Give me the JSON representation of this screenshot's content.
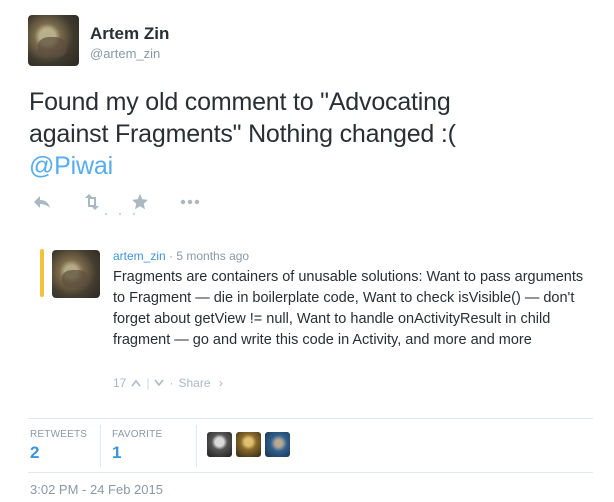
{
  "author": {
    "display_name": "Artem Zin",
    "handle": "@artem_zin"
  },
  "tweet": {
    "text_line1": "Found my old comment to \"Advocating",
    "text_line2": "against Fragments\" Nothing changed :(",
    "mention": "@Piwai"
  },
  "actions": {
    "icons": [
      "reply-icon",
      "retweet-icon",
      "favorite-icon",
      "more-icon"
    ]
  },
  "quoted": {
    "username": "artem_zin",
    "separator": "·",
    "time": "5 months ago",
    "text": "Fragments are containers of unusable solutions: Want to pass arguments to Fragment — die in boilerplate code, Want to check isVisible() — don't forget about getView != null, Want to handle onActivityResult in child fragment — go and write this code in Activity, and more and more",
    "votes": "17",
    "share_label": "Share",
    "accent_color": "#f2c23a"
  },
  "stats": {
    "retweets_label": "RETWEETS",
    "retweets_value": "2",
    "favorites_label": "FAVORITE",
    "favorites_value": "1"
  },
  "timestamp": "3:02 PM - 24 Feb 2015",
  "colors": {
    "link": "#55acee",
    "stat_value": "#3b94d9",
    "muted": "#8899a6",
    "border": "#e1e8ed"
  }
}
